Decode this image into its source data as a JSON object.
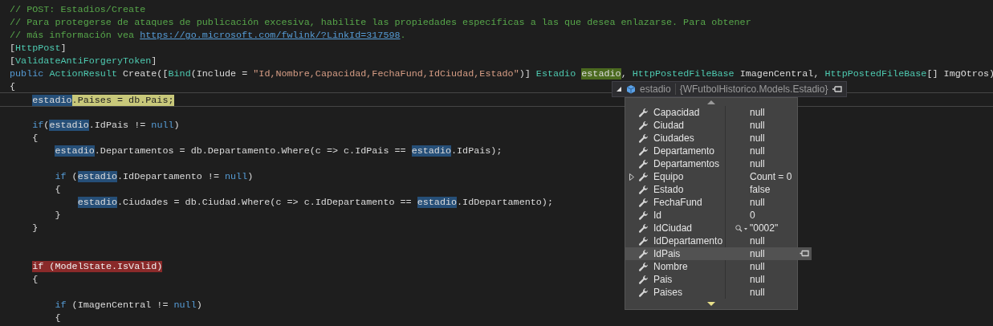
{
  "editor": {
    "lines": [
      {
        "kind": "code",
        "tokens": [
          {
            "text": "// POST: Estadios/Create",
            "kind": "comment"
          }
        ]
      },
      {
        "kind": "code",
        "tokens": [
          {
            "text": "// Para protegerse de ataques de publicación excesiva, habilite las propiedades específicas a las que desea enlazarse. Para obtener",
            "kind": "comment"
          }
        ]
      },
      {
        "kind": "code",
        "tokens": [
          {
            "text": "// más información vea ",
            "kind": "comment"
          },
          {
            "text": "https://go.microsoft.com/fwlink/?LinkId=317598",
            "kind": "link"
          },
          {
            "text": ".",
            "kind": "comment"
          }
        ]
      },
      {
        "kind": "code",
        "tokens": [
          {
            "text": "[",
            "kind": "plain"
          },
          {
            "text": "HttpPost",
            "kind": "type"
          },
          {
            "text": "]",
            "kind": "plain"
          }
        ]
      },
      {
        "kind": "code",
        "tokens": [
          {
            "text": "[",
            "kind": "plain"
          },
          {
            "text": "ValidateAntiForgeryToken",
            "kind": "type"
          },
          {
            "text": "]",
            "kind": "plain"
          }
        ]
      },
      {
        "kind": "code",
        "tokens": [
          {
            "text": "public",
            "kind": "keyword"
          },
          {
            "text": " ActionResult",
            "kind": "type"
          },
          {
            "text": " Create([",
            "kind": "plain"
          },
          {
            "text": "Bind",
            "kind": "type"
          },
          {
            "text": "(Include = ",
            "kind": "plain"
          },
          {
            "text": "\"Id,Nombre,Capacidad,FechaFund,IdCiudad,Estado\"",
            "kind": "string"
          },
          {
            "text": ")] ",
            "kind": "plain"
          },
          {
            "text": "Estadio",
            "kind": "type"
          },
          {
            "text": " estadio",
            "kind": "definition"
          },
          {
            "text": ", ",
            "kind": "plain"
          },
          {
            "text": "HttpPostedFileBase",
            "kind": "type"
          },
          {
            "text": " ImagenCentral, ",
            "kind": "plain"
          },
          {
            "text": "HttpPostedFileBase",
            "kind": "type"
          },
          {
            "text": "[] ImgOtros)",
            "kind": "plain"
          }
        ]
      },
      {
        "kind": "code",
        "tokens": [
          {
            "text": "{",
            "kind": "plain"
          }
        ]
      },
      {
        "kind": "code",
        "current": true,
        "tokens": [
          {
            "text": "    estadio",
            "kind": "reference"
          },
          {
            "text": ".Paises = db.Pais;",
            "kind": "statement"
          }
        ]
      },
      {
        "kind": "blank"
      },
      {
        "kind": "code",
        "tokens": [
          {
            "text": "    if",
            "kind": "keyword"
          },
          {
            "text": "(",
            "kind": "plain"
          },
          {
            "text": "estadio",
            "kind": "reference"
          },
          {
            "text": ".IdPais != ",
            "kind": "plain"
          },
          {
            "text": "null",
            "kind": "keyword"
          },
          {
            "text": ")",
            "kind": "plain"
          }
        ]
      },
      {
        "kind": "code",
        "tokens": [
          {
            "text": "    {",
            "kind": "plain"
          }
        ]
      },
      {
        "kind": "code",
        "tokens": [
          {
            "text": "        estadio",
            "kind": "reference"
          },
          {
            "text": ".Departamentos = db.Departamento.Where(c => c.IdPais == ",
            "kind": "plain"
          },
          {
            "text": "estadio",
            "kind": "reference"
          },
          {
            "text": ".IdPais);",
            "kind": "plain"
          }
        ]
      },
      {
        "kind": "blank"
      },
      {
        "kind": "code",
        "tokens": [
          {
            "text": "        if",
            "kind": "keyword"
          },
          {
            "text": " (",
            "kind": "plain"
          },
          {
            "text": "estadio",
            "kind": "reference"
          },
          {
            "text": ".IdDepartamento != ",
            "kind": "plain"
          },
          {
            "text": "null",
            "kind": "keyword"
          },
          {
            "text": ")",
            "kind": "plain"
          }
        ]
      },
      {
        "kind": "code",
        "tokens": [
          {
            "text": "        {",
            "kind": "plain"
          }
        ]
      },
      {
        "kind": "code",
        "tokens": [
          {
            "text": "            estadio",
            "kind": "reference"
          },
          {
            "text": ".Ciudades = db.Ciudad.Where(c => c.IdDepartamento == ",
            "kind": "plain"
          },
          {
            "text": "estadio",
            "kind": "reference"
          },
          {
            "text": ".IdDepartamento);",
            "kind": "plain"
          }
        ]
      },
      {
        "kind": "code",
        "tokens": [
          {
            "text": "        }",
            "kind": "plain"
          }
        ]
      },
      {
        "kind": "code",
        "tokens": [
          {
            "text": "    }",
            "kind": "plain"
          }
        ]
      },
      {
        "kind": "blank"
      },
      {
        "kind": "blank"
      },
      {
        "kind": "code",
        "tokens": [
          {
            "text": "    if (ModelState.IsValid)",
            "kind": "breakpoint"
          }
        ]
      },
      {
        "kind": "code",
        "tokens": [
          {
            "text": "    {",
            "kind": "plain"
          }
        ]
      },
      {
        "kind": "blank"
      },
      {
        "kind": "code",
        "tokens": [
          {
            "text": "        if",
            "kind": "keyword"
          },
          {
            "text": " (ImagenCentral != ",
            "kind": "plain"
          },
          {
            "text": "null",
            "kind": "keyword"
          },
          {
            "text": ")",
            "kind": "plain"
          }
        ]
      },
      {
        "kind": "code",
        "tokens": [
          {
            "text": "        {",
            "kind": "plain"
          }
        ]
      }
    ]
  },
  "datatip": {
    "expanded": true,
    "name": "estadio",
    "type": "{WFutbolHistorico.Models.Estadio}",
    "members": [
      {
        "name": "Capacidad",
        "value": "null",
        "expandable": false,
        "selected": false,
        "visualizer": false
      },
      {
        "name": "Ciudad",
        "value": "null",
        "expandable": false,
        "selected": false,
        "visualizer": false
      },
      {
        "name": "Ciudades",
        "value": "null",
        "expandable": false,
        "selected": false,
        "visualizer": false
      },
      {
        "name": "Departamento",
        "value": "null",
        "expandable": false,
        "selected": false,
        "visualizer": false
      },
      {
        "name": "Departamentos",
        "value": "null",
        "expandable": false,
        "selected": false,
        "visualizer": false
      },
      {
        "name": "Equipo",
        "value": "Count = 0",
        "expandable": true,
        "selected": false,
        "visualizer": false
      },
      {
        "name": "Estado",
        "value": "false",
        "expandable": false,
        "selected": false,
        "visualizer": false
      },
      {
        "name": "FechaFund",
        "value": "null",
        "expandable": false,
        "selected": false,
        "visualizer": false
      },
      {
        "name": "Id",
        "value": "0",
        "expandable": false,
        "selected": false,
        "visualizer": false
      },
      {
        "name": "IdCiudad",
        "value": "\"0002\"",
        "expandable": false,
        "selected": false,
        "visualizer": true
      },
      {
        "name": "IdDepartamento",
        "value": "null",
        "expandable": false,
        "selected": false,
        "visualizer": false
      },
      {
        "name": "IdPais",
        "value": "null",
        "expandable": false,
        "selected": true,
        "visualizer": false
      },
      {
        "name": "Nombre",
        "value": "null",
        "expandable": false,
        "selected": false,
        "visualizer": false
      },
      {
        "name": "Pais",
        "value": "null",
        "expandable": false,
        "selected": false,
        "visualizer": false
      },
      {
        "name": "Paises",
        "value": "null",
        "expandable": false,
        "selected": false,
        "visualizer": false
      }
    ]
  }
}
